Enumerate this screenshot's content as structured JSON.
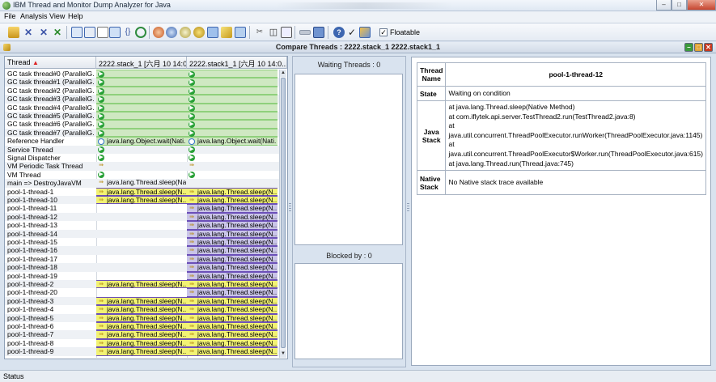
{
  "window": {
    "title": "IBM Thread and Monitor Dump Analyzer for Java"
  },
  "menu": [
    "File",
    "Analysis",
    "View",
    "Help"
  ],
  "toolbar": {
    "floatable_label": "Floatable",
    "floatable_checked": true
  },
  "internal_frame": {
    "title": "Compare Threads : 2222.stack_1 2222.stack1_1"
  },
  "thread_table": {
    "sort_arrow": "▲",
    "headers": [
      "Thread",
      "2222.stack_1 [六月 10 14:04...",
      "2222.stack1_1 [六月 10 14:0..."
    ],
    "rows": [
      {
        "name": "GC task thread#0 (ParallelG...",
        "c1": {
          "state": "run",
          "color": "green",
          "text": ""
        },
        "c2": {
          "state": "run",
          "color": "green",
          "text": ""
        }
      },
      {
        "name": "GC task thread#1 (ParallelG...",
        "c1": {
          "state": "run",
          "color": "green",
          "text": ""
        },
        "c2": {
          "state": "run",
          "color": "green",
          "text": ""
        }
      },
      {
        "name": "GC task thread#2 (ParallelG...",
        "c1": {
          "state": "run",
          "color": "green",
          "text": ""
        },
        "c2": {
          "state": "run",
          "color": "green",
          "text": ""
        }
      },
      {
        "name": "GC task thread#3 (ParallelG...",
        "c1": {
          "state": "run",
          "color": "green",
          "text": ""
        },
        "c2": {
          "state": "run",
          "color": "green",
          "text": ""
        }
      },
      {
        "name": "GC task thread#4 (ParallelG...",
        "c1": {
          "state": "run",
          "color": "green",
          "text": ""
        },
        "c2": {
          "state": "run",
          "color": "green",
          "text": ""
        }
      },
      {
        "name": "GC task thread#5 (ParallelG...",
        "c1": {
          "state": "run",
          "color": "green",
          "text": ""
        },
        "c2": {
          "state": "run",
          "color": "green",
          "text": ""
        }
      },
      {
        "name": "GC task thread#6 (ParallelG...",
        "c1": {
          "state": "run",
          "color": "green",
          "text": ""
        },
        "c2": {
          "state": "run",
          "color": "green",
          "text": ""
        }
      },
      {
        "name": "GC task thread#7 (ParallelG...",
        "c1": {
          "state": "run",
          "color": "green",
          "text": ""
        },
        "c2": {
          "state": "run",
          "color": "green",
          "text": ""
        }
      },
      {
        "name": "Reference Handler",
        "c1": {
          "state": "wait",
          "color": "green",
          "text": "java.lang.Object.wait(Nati..."
        },
        "c2": {
          "state": "wait",
          "color": "green",
          "text": "java.lang.Object.wait(Nati..."
        }
      },
      {
        "name": "Service Thread",
        "c1": {
          "state": "run",
          "color": "white",
          "text": ""
        },
        "c2": {
          "state": "run",
          "color": "white",
          "text": ""
        }
      },
      {
        "name": "Signal Dispatcher",
        "c1": {
          "state": "run",
          "color": "white",
          "text": ""
        },
        "c2": {
          "state": "run",
          "color": "white",
          "text": ""
        }
      },
      {
        "name": "VM Periodic Task Thread",
        "c1": {
          "state": "park",
          "color": "white",
          "text": ""
        },
        "c2": {
          "state": "park",
          "color": "white",
          "text": ""
        }
      },
      {
        "name": "VM Thread",
        "c1": {
          "state": "run",
          "color": "white",
          "text": ""
        },
        "c2": {
          "state": "run",
          "color": "white",
          "text": ""
        }
      },
      {
        "name": "main => DestroyJavaVM",
        "c1": {
          "state": "park",
          "color": "white",
          "text": "java.lang.Thread.sleep(Na..."
        },
        "c2": {
          "state": "",
          "color": "white",
          "text": ""
        }
      },
      {
        "name": "pool-1-thread-1",
        "c1": {
          "state": "park",
          "color": "yellow",
          "text": "java.lang.Thread.sleep(N..."
        },
        "c2": {
          "state": "park",
          "color": "yellow",
          "text": "java.lang.Thread.sleep(N..."
        }
      },
      {
        "name": "pool-1-thread-10",
        "c1": {
          "state": "park",
          "color": "yellow",
          "text": "java.lang.Thread.sleep(N..."
        },
        "c2": {
          "state": "park",
          "color": "yellow",
          "text": "java.lang.Thread.sleep(N..."
        }
      },
      {
        "name": "pool-1-thread-11",
        "c1": {
          "state": "",
          "color": "white",
          "text": ""
        },
        "c2": {
          "state": "park",
          "color": "purple",
          "text": "java.lang.Thread.sleep(N..."
        }
      },
      {
        "name": "pool-1-thread-12",
        "c1": {
          "state": "",
          "color": "white",
          "text": ""
        },
        "c2": {
          "state": "park",
          "color": "purple",
          "text": "java.lang.Thread.sleep(N..."
        }
      },
      {
        "name": "pool-1-thread-13",
        "c1": {
          "state": "",
          "color": "white",
          "text": ""
        },
        "c2": {
          "state": "park",
          "color": "purple",
          "text": "java.lang.Thread.sleep(N..."
        }
      },
      {
        "name": "pool-1-thread-14",
        "c1": {
          "state": "",
          "color": "white",
          "text": ""
        },
        "c2": {
          "state": "park",
          "color": "purple",
          "text": "java.lang.Thread.sleep(N..."
        }
      },
      {
        "name": "pool-1-thread-15",
        "c1": {
          "state": "",
          "color": "white",
          "text": ""
        },
        "c2": {
          "state": "park",
          "color": "purple",
          "text": "java.lang.Thread.sleep(N..."
        }
      },
      {
        "name": "pool-1-thread-16",
        "c1": {
          "state": "",
          "color": "white",
          "text": ""
        },
        "c2": {
          "state": "park",
          "color": "purple",
          "text": "java.lang.Thread.sleep(N..."
        }
      },
      {
        "name": "pool-1-thread-17",
        "c1": {
          "state": "",
          "color": "white",
          "text": ""
        },
        "c2": {
          "state": "park",
          "color": "purple",
          "text": "java.lang.Thread.sleep(N..."
        }
      },
      {
        "name": "pool-1-thread-18",
        "c1": {
          "state": "",
          "color": "white",
          "text": ""
        },
        "c2": {
          "state": "park",
          "color": "purple",
          "text": "java.lang.Thread.sleep(N..."
        }
      },
      {
        "name": "pool-1-thread-19",
        "c1": {
          "state": "",
          "color": "white",
          "text": ""
        },
        "c2": {
          "state": "park",
          "color": "purple",
          "text": "java.lang.Thread.sleep(N..."
        }
      },
      {
        "name": "pool-1-thread-2",
        "c1": {
          "state": "park",
          "color": "yellow",
          "text": "java.lang.Thread.sleep(N..."
        },
        "c2": {
          "state": "park",
          "color": "yellow",
          "text": "java.lang.Thread.sleep(N..."
        }
      },
      {
        "name": "pool-1-thread-20",
        "c1": {
          "state": "",
          "color": "white",
          "text": ""
        },
        "c2": {
          "state": "park",
          "color": "purple",
          "text": "java.lang.Thread.sleep(N..."
        }
      },
      {
        "name": "pool-1-thread-3",
        "c1": {
          "state": "park",
          "color": "yellow",
          "text": "java.lang.Thread.sleep(N..."
        },
        "c2": {
          "state": "park",
          "color": "yellow",
          "text": "java.lang.Thread.sleep(N..."
        }
      },
      {
        "name": "pool-1-thread-4",
        "c1": {
          "state": "park",
          "color": "yellow",
          "text": "java.lang.Thread.sleep(N..."
        },
        "c2": {
          "state": "park",
          "color": "yellow",
          "text": "java.lang.Thread.sleep(N..."
        }
      },
      {
        "name": "pool-1-thread-5",
        "c1": {
          "state": "park",
          "color": "yellow",
          "text": "java.lang.Thread.sleep(N..."
        },
        "c2": {
          "state": "park",
          "color": "yellow",
          "text": "java.lang.Thread.sleep(N..."
        }
      },
      {
        "name": "pool-1-thread-6",
        "c1": {
          "state": "park",
          "color": "yellow",
          "text": "java.lang.Thread.sleep(N..."
        },
        "c2": {
          "state": "park",
          "color": "yellow",
          "text": "java.lang.Thread.sleep(N..."
        }
      },
      {
        "name": "pool-1-thread-7",
        "c1": {
          "state": "park",
          "color": "yellow",
          "text": "java.lang.Thread.sleep(N..."
        },
        "c2": {
          "state": "park",
          "color": "yellow",
          "text": "java.lang.Thread.sleep(N..."
        }
      },
      {
        "name": "pool-1-thread-8",
        "c1": {
          "state": "park",
          "color": "yellow",
          "text": "java.lang.Thread.sleep(N..."
        },
        "c2": {
          "state": "park",
          "color": "yellow",
          "text": "java.lang.Thread.sleep(N..."
        }
      },
      {
        "name": "pool-1-thread-9",
        "c1": {
          "state": "park",
          "color": "yellow",
          "text": "java.lang.Thread.sleep(N..."
        },
        "c2": {
          "state": "park",
          "color": "yellow",
          "text": "java.lang.Thread.sleep(N..."
        }
      }
    ]
  },
  "middle": {
    "waiting_label": "Waiting Threads : 0",
    "blocked_label": "Blocked by : 0"
  },
  "details": {
    "thread_name_key": "Thread Name",
    "thread_name_value": "pool-1-thread-12",
    "state_key": "State",
    "state_value": "Waiting on condition",
    "java_stack_key": "Java Stack",
    "java_stack_lines": [
      "at java.lang.Thread.sleep(Native Method)",
      "at com.iflytek.api.server.TestThread2.run(TestThread2.java:8)",
      "at",
      "java.util.concurrent.ThreadPoolExecutor.runWorker(ThreadPoolExecutor.java:1145)",
      "at",
      "java.util.concurrent.ThreadPoolExecutor$Worker.run(ThreadPoolExecutor.java:615)",
      "at java.lang.Thread.run(Thread.java:745)"
    ],
    "native_stack_key": "Native Stack",
    "native_stack_value": "No Native stack trace available"
  },
  "status": {
    "text": "Status"
  },
  "colors": {
    "running": "#28a036",
    "waiting_cell": "#cfe8c2",
    "sleeping_cell": "#f2f274",
    "new_cell": "#c9c4e8"
  }
}
